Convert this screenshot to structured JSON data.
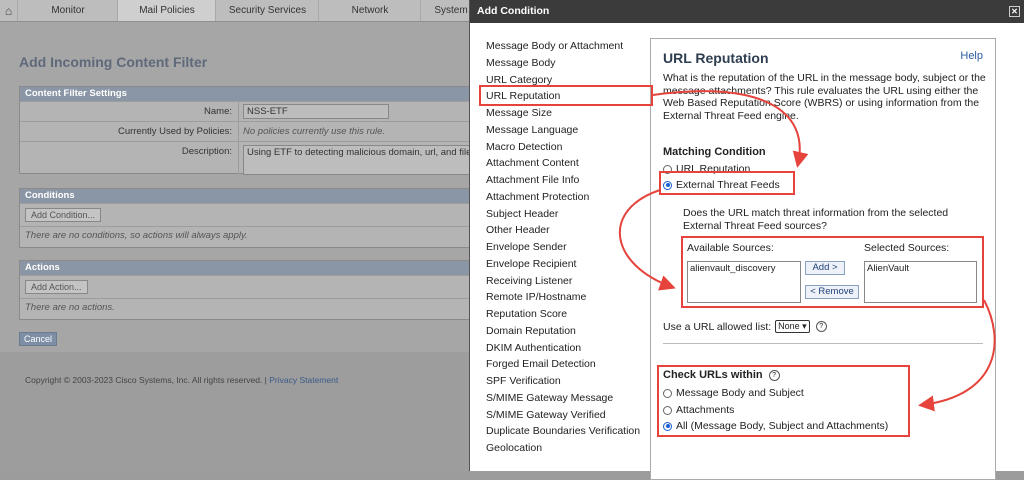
{
  "nav": {
    "tabs": [
      "Monitor",
      "Mail Policies",
      "Security Services",
      "Network",
      "System"
    ],
    "active_tab": "Mail Policies"
  },
  "page": {
    "title": "Add Incoming Content Filter",
    "settings_header": "Content Filter Settings",
    "name_label": "Name:",
    "name_value": "NSS-ETF",
    "used_by_label": "Currently Used by Policies:",
    "used_by_value": "No policies currently use this rule.",
    "description_label": "Description:",
    "description_value": "Using ETF to detecting malicious domain, url, and file",
    "conditions_header": "Conditions",
    "add_condition_label": "Add Condition...",
    "conditions_empty": "There are no conditions, so actions will always apply.",
    "actions_header": "Actions",
    "add_action_label": "Add Action...",
    "actions_empty": "There are no actions.",
    "cancel_label": "Cancel",
    "copyright": "Copyright © 2003-2023 Cisco Systems, Inc. All rights reserved. | ",
    "privacy_label": "Privacy Statement"
  },
  "dialog": {
    "title": "Add Condition",
    "conditions": [
      "Message Body or Attachment",
      "Message Body",
      "URL Category",
      "URL Reputation",
      "Message Size",
      "Message Language",
      "Macro Detection",
      "Attachment Content",
      "Attachment File Info",
      "Attachment Protection",
      "Subject Header",
      "Other Header",
      "Envelope Sender",
      "Envelope Recipient",
      "Receiving Listener",
      "Remote IP/Hostname",
      "Reputation Score",
      "Domain Reputation",
      "DKIM Authentication",
      "Forged Email Detection",
      "SPF Verification",
      "S/MIME Gateway Message",
      "S/MIME Gateway Verified",
      "Duplicate Boundaries Verification",
      "Geolocation"
    ],
    "selected_condition": "URL Reputation",
    "pane_title": "URL Reputation",
    "help_label": "Help",
    "description": "What is the reputation of the URL in the message body, subject or the message attachments? This rule evaluates the URL using either the Web Based Reputation Score (WBRS) or using information from the External Threat Feed engine.",
    "matching_condition_label": "Matching Condition",
    "opt_url_reputation": "URL Reputation",
    "opt_external_feeds": "External Threat Feeds",
    "feed_question": "Does the URL match threat information from the selected External Threat Feed sources?",
    "available_label": "Available Sources:",
    "selected_label": "Selected Sources:",
    "available_sources": [
      "alienvault_discovery"
    ],
    "selected_sources": [
      "AlienVault"
    ],
    "add_label": "Add >",
    "remove_label": "< Remove",
    "allowed_list_label": "Use a URL allowed list:",
    "allowed_list_value": "None",
    "check_urls_label": "Check URLs within",
    "opt_body_subject": "Message Body and Subject",
    "opt_attachments": "Attachments",
    "opt_all": "All (Message Body, Subject and Attachments)"
  },
  "colors": {
    "annotation": "#e5433b",
    "dialog_title_bg": "#3b3b3b",
    "radio_selected": "#1a5fd1"
  }
}
